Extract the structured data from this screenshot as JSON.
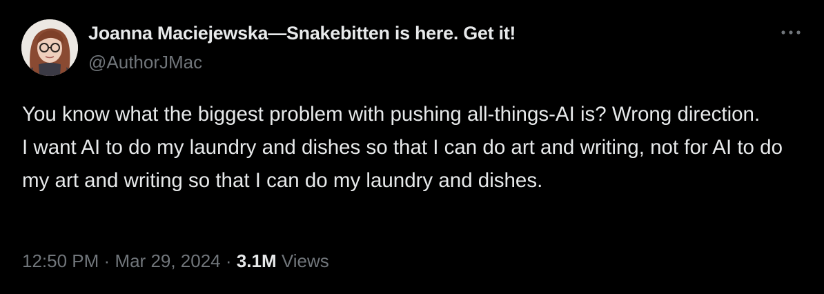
{
  "author": {
    "display_name": "Joanna Maciejewska—Snakebitten is here. Get it!",
    "handle": "@AuthorJMac",
    "avatar_icon": "profile-photo"
  },
  "tweet": {
    "text_lines": [
      "You know what the biggest problem with pushing all-things-AI is? Wrong direction.",
      "I want AI to do my laundry and dishes so that I can do art and writing, not for AI to do my art and writing so that I can do my laundry and dishes."
    ]
  },
  "meta": {
    "time": "12:50 PM",
    "separator": "·",
    "date": "Mar 29, 2024",
    "views_count": "3.1M",
    "views_label": "Views"
  },
  "actions": {
    "more_icon": "more-horizontal-icon"
  },
  "colors": {
    "background": "#000000",
    "primary_text": "#e7e9ea",
    "secondary_text": "#71767b"
  }
}
